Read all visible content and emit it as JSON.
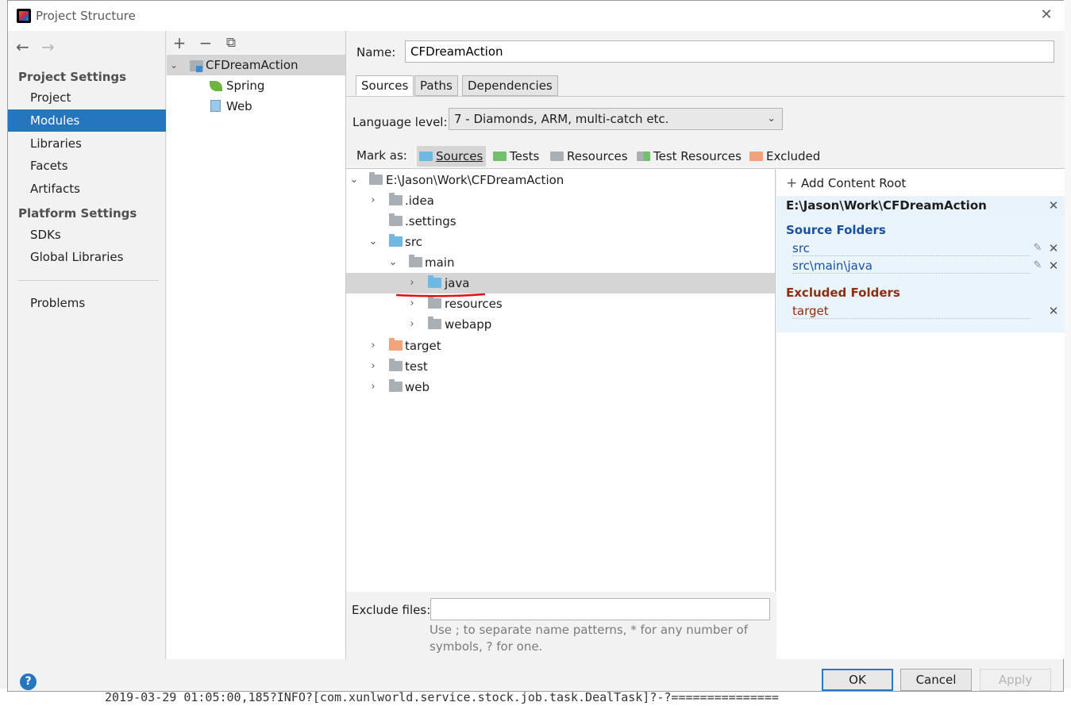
{
  "window": {
    "title": "Project Structure"
  },
  "background": {
    "log_line": "2019-03-29 01:05:00,185?INFO?[com.xunlworld.service.stock.job.task.DealTask]?-?==============="
  },
  "nav": {
    "project_settings_header": "Project Settings",
    "platform_settings_header": "Platform Settings",
    "items": [
      "Project",
      "Modules",
      "Libraries",
      "Facets",
      "Artifacts"
    ],
    "platform_items": [
      "SDKs",
      "Global Libraries"
    ],
    "problems": "Problems",
    "selected": "Modules"
  },
  "modules": {
    "toolbar": {
      "add": "+",
      "remove": "−",
      "copy": "⧉"
    },
    "root": "CFDreamAction",
    "children": [
      "Spring",
      "Web"
    ]
  },
  "module": {
    "name_label": "Name:",
    "name_value": "CFDreamAction",
    "tabs": [
      "Sources",
      "Paths",
      "Dependencies"
    ],
    "active_tab": "Sources",
    "language_level_label": "Language level:",
    "language_level_value": "7 - Diamonds, ARM, multi-catch etc.",
    "mark_as_label": "Mark as:",
    "mark_as": [
      "Sources",
      "Tests",
      "Resources",
      "Test Resources",
      "Excluded"
    ],
    "tree": {
      "root": "E:\\Jason\\Work\\CFDreamAction",
      "items": [
        ".idea",
        ".settings",
        "src",
        "main",
        "java",
        "resources",
        "webapp",
        "target",
        "test",
        "web"
      ],
      "selected": "java"
    },
    "exclude_files_label": "Exclude files:",
    "exclude_files_value": "",
    "exclude_hint_1": "Use ; to separate name patterns, * for any number of",
    "exclude_hint_2": "symbols, ? for one."
  },
  "content_root": {
    "add_label": "Add Content Root",
    "path": "E:\\Jason\\Work\\CFDreamAction",
    "source_folders_title": "Source Folders",
    "source_folders": [
      "src",
      "src\\main\\java"
    ],
    "excluded_folders_title": "Excluded Folders",
    "excluded_folders": [
      "target"
    ]
  },
  "buttons": {
    "ok": "OK",
    "cancel": "Cancel",
    "apply": "Apply",
    "help": "?"
  },
  "colors": {
    "selection": "#2675bf",
    "source_folder": "#6fb8e4",
    "test_folder": "#72c06c",
    "excluded_folder": "#f1a37a",
    "plain_folder": "#a8afb5",
    "source_text": "#1b50a0",
    "excluded_text": "#8f2e0a"
  }
}
